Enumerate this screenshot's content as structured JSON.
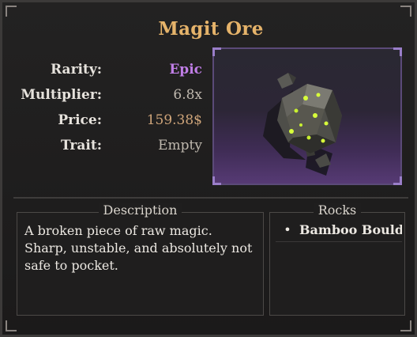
{
  "title": "Magit Ore",
  "stats": [
    {
      "label": "Rarity:",
      "value": "Epic"
    },
    {
      "label": "Multiplier:",
      "value": "6.8x"
    },
    {
      "label": "Price:",
      "value": "159.38$"
    },
    {
      "label": "Trait:",
      "value": "Empty"
    }
  ],
  "colors": {
    "title": "#e5b36a",
    "epic": "#c07ee6",
    "ore_glow": "#d8ff3a"
  },
  "description": {
    "header": "Description",
    "text": "A broken piece of raw magic. Sharp, unstable, and absolutely not safe to pocket."
  },
  "rocks": {
    "header": "Rocks",
    "items": [
      "Bamboo Bould"
    ]
  }
}
